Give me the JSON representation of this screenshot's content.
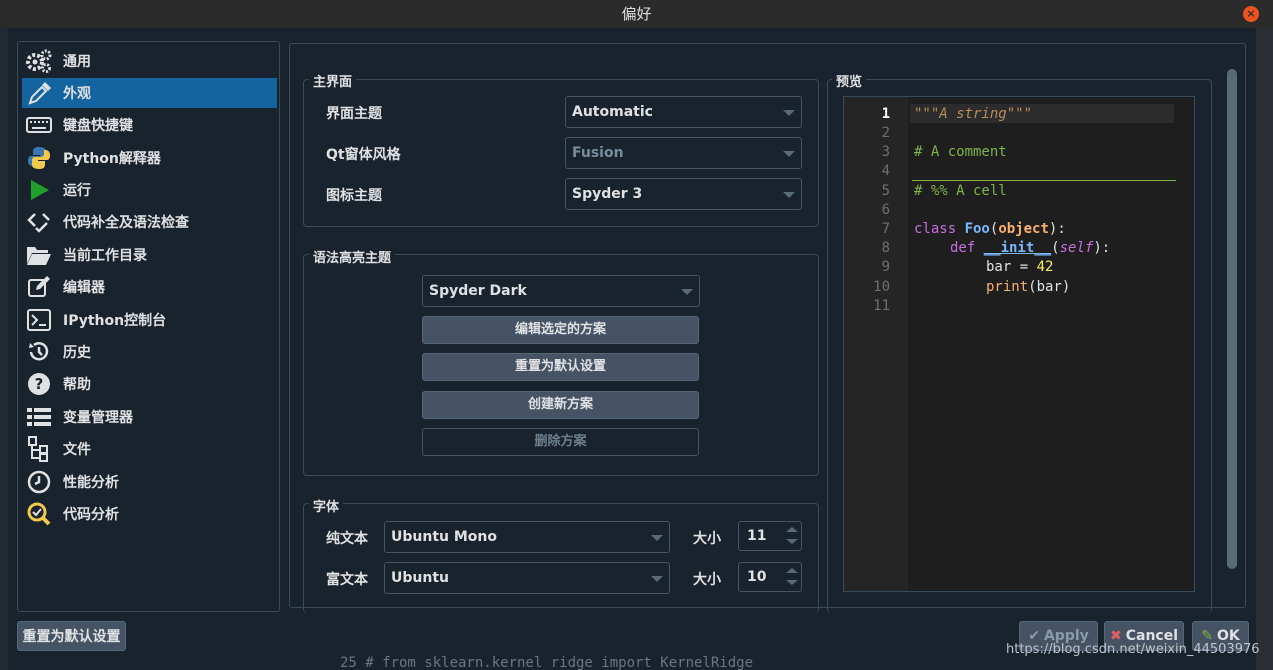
{
  "window": {
    "title": "偏好",
    "close_icon": "×"
  },
  "sidebar": {
    "items": [
      {
        "label": "通用",
        "icon": "gears-icon"
      },
      {
        "label": "外观",
        "icon": "eyedropper-icon",
        "active": true
      },
      {
        "label": "键盘快捷键",
        "icon": "keyboard-icon"
      },
      {
        "label": "Python解释器",
        "icon": "python-icon"
      },
      {
        "label": "运行",
        "icon": "play-icon"
      },
      {
        "label": "代码补全及语法检查",
        "icon": "code-check-icon"
      },
      {
        "label": "当前工作目录",
        "icon": "folder-icon"
      },
      {
        "label": "编辑器",
        "icon": "edit-icon"
      },
      {
        "label": "IPython控制台",
        "icon": "terminal-icon"
      },
      {
        "label": "历史",
        "icon": "history-icon"
      },
      {
        "label": "帮助",
        "icon": "help-icon"
      },
      {
        "label": "变量管理器",
        "icon": "table-icon"
      },
      {
        "label": "文件",
        "icon": "file-tree-icon"
      },
      {
        "label": "性能分析",
        "icon": "clock-icon"
      },
      {
        "label": "代码分析",
        "icon": "code-analysis-icon"
      }
    ]
  },
  "main_interface": {
    "title": "主界面",
    "ui_theme_label": "界面主题",
    "ui_theme_value": "Automatic",
    "qt_style_label": "Qt窗体风格",
    "qt_style_value": "Fusion",
    "icon_theme_label": "图标主题",
    "icon_theme_value": "Spyder 3"
  },
  "syntax": {
    "title": "语法高亮主题",
    "scheme_value": "Spyder Dark",
    "edit_button": "编辑选定的方案",
    "reset_button": "重置为默认设置",
    "create_button": "创建新方案",
    "delete_button": "删除方案"
  },
  "fonts": {
    "title": "字体",
    "plain_label": "纯文本",
    "plain_value": "Ubuntu Mono",
    "plain_size_label": "大小",
    "plain_size": "11",
    "rich_label": "富文本",
    "rich_value": "Ubuntu",
    "rich_size_label": "大小",
    "rich_size": "10"
  },
  "preview": {
    "title": "预览",
    "line_numbers": [
      "1",
      "2",
      "3",
      "4",
      "5",
      "6",
      "7",
      "8",
      "9",
      "10",
      "11"
    ],
    "code": {
      "l1": "\"\"\"A string\"\"\"",
      "l3": "# A comment",
      "l5": "# %% A cell",
      "l7_kw": "class ",
      "l7_name": "Foo",
      "l7_open": "(",
      "l7_base": "object",
      "l7_close": "):",
      "l8_kw": "def ",
      "l8_name": "__init__",
      "l8_open": "(",
      "l8_self": "self",
      "l8_close": "):",
      "l9_a": "bar = ",
      "l9_num": "42",
      "l10_fn": "print",
      "l10_rest": "(bar)"
    },
    "colors": {
      "string": "#b68c5a",
      "comment": "#7fb347",
      "keyword": "#c670e0",
      "name": "#79b8ff",
      "number": "#faed5c",
      "builtin": "#fab16c"
    }
  },
  "footer": {
    "reset_defaults": "重置为默认设置",
    "apply": "Apply",
    "cancel": "Cancel",
    "ok": "OK",
    "watermark": "https://blog.csdn.net/weixin_44503976",
    "background_code": "25      # from sklearn.kernel_ridge import KernelRidge"
  }
}
